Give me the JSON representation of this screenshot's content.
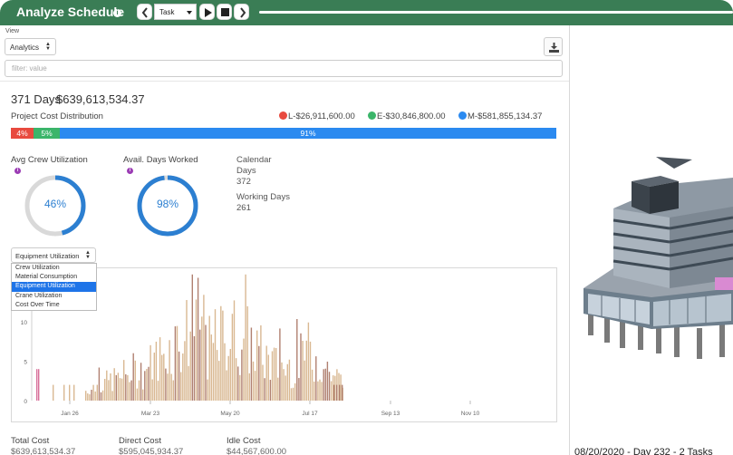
{
  "header": {
    "title": "Analyze Schedule",
    "info_icon": "info-icon",
    "task_select_value": "Task",
    "icons": [
      "chevron-left-icon",
      "play-icon",
      "stop-icon",
      "chevron-right-icon"
    ]
  },
  "view": {
    "label": "View",
    "selected": "Analytics",
    "filter_placeholder": "filter: value"
  },
  "summary": {
    "days": "371 Days",
    "cost": "$639,613,534.37",
    "distribution_label": "Project Cost Distribution",
    "legend": [
      {
        "label": "L-$26,911,600.00",
        "color": "#e84a3f"
      },
      {
        "label": "E-$30,846,800.00",
        "color": "#3bb56a"
      },
      {
        "label": "M-$581,855,134.37",
        "color": "#2b8af0"
      }
    ],
    "segments": [
      {
        "label": "4%",
        "percent": 4.2,
        "color": "#e84a3f"
      },
      {
        "label": "5%",
        "percent": 4.8,
        "color": "#3bb56a"
      },
      {
        "label": "91%",
        "percent": 91,
        "color": "#2b8af0"
      }
    ]
  },
  "metrics": {
    "crew": {
      "label": "Avg Crew Utilization",
      "value": "46%",
      "fraction": 0.46
    },
    "days_worked": {
      "label": "Avail. Days Worked",
      "value": "98%",
      "fraction": 0.98
    },
    "calendar_days_label_1": "Calendar",
    "calendar_days_label_2": "Days",
    "calendar_days_value": "372",
    "working_days_label": "Working Days",
    "working_days_value": "261"
  },
  "chart_select": {
    "selected": "Equipment Utilization",
    "options": [
      "Crew Utilization",
      "Material Consumption",
      "Equipment Utilization",
      "Crane Utilization",
      "Cost Over Time"
    ],
    "selected_index": 2
  },
  "chart_data": {
    "type": "bar",
    "ylim": [
      0,
      20
    ],
    "yticks": [
      "0",
      "5",
      "10"
    ],
    "xticks": [
      "Jan 26",
      "Mar 23",
      "May 20",
      "Jul 17",
      "Sep 13",
      "Nov 10"
    ],
    "colors": {
      "main": "#d9b892",
      "alt": "#b08070",
      "early": "#d8709a"
    }
  },
  "costs": [
    {
      "label": "Total Cost",
      "value": "$639,613,534.37"
    },
    {
      "label": "Direct Cost",
      "value": "$595,045,934.37"
    },
    {
      "label": "Idle Cost",
      "value": "$44,567,600.00"
    }
  ],
  "viewport": {
    "status": "08/20/2020 - Day 232 - 2 Tasks"
  }
}
